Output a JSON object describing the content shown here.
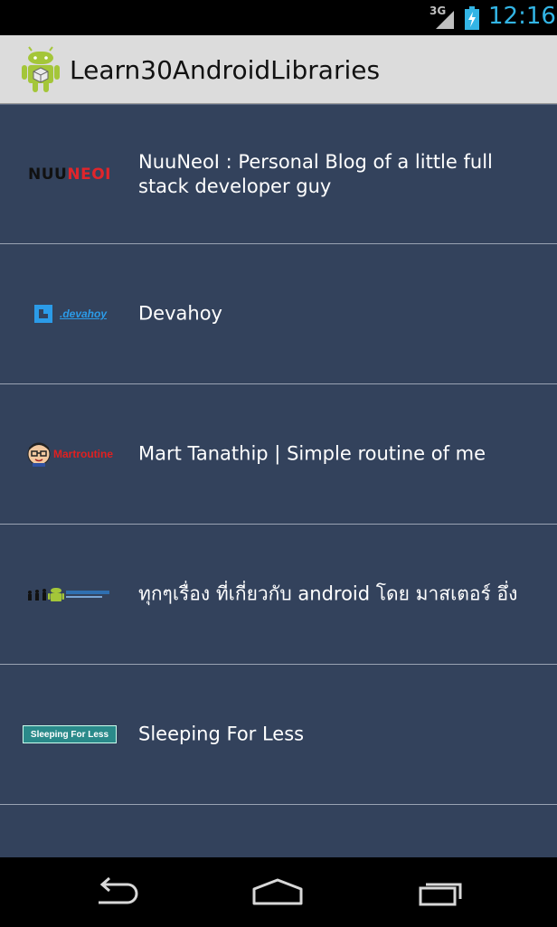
{
  "status_bar": {
    "network_type": "3G",
    "clock": "12:16"
  },
  "action_bar": {
    "title": "Learn30AndroidLibraries"
  },
  "list": {
    "items": [
      {
        "label": "NuuNeoI : Personal Blog of a little full stack developer guy",
        "logo": "nuuneoi",
        "logo_text_1": "NUU",
        "logo_text_2": "NEOI"
      },
      {
        "label": "Devahoy",
        "logo": "devahoy",
        "logo_text_1": ".devahoy"
      },
      {
        "label": "Mart Tanathip | Simple routine of me",
        "logo": "martroutine",
        "logo_text_1": "Martroutine"
      },
      {
        "label": "ทุกๆเรื่อง ที่เกี่ยวกับ android โดย มาสเตอร์ อึ่ง",
        "logo": "masterung"
      },
      {
        "label": "Sleeping For Less",
        "logo": "sleeping-for-less",
        "logo_text_1": "Sleeping For Less"
      }
    ]
  },
  "colors": {
    "list_background": "#33425c",
    "action_bar": "#dcdcdc",
    "clock": "#33b5e5"
  },
  "icons": {
    "back": "back-icon",
    "home": "home-icon",
    "recents": "recents-icon"
  }
}
